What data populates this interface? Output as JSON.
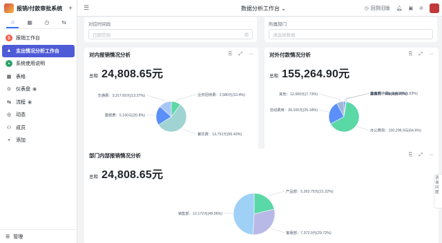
{
  "app": {
    "title": "报销/付款审批系统",
    "add_icon": "plus-icon"
  },
  "sidebar": {
    "tabs": [
      {
        "name": "home",
        "icon": "home-icon",
        "active": true
      },
      {
        "name": "table",
        "icon": "table-icon",
        "active": false
      },
      {
        "name": "history",
        "icon": "clock-icon",
        "active": false
      },
      {
        "name": "workflow",
        "icon": "flow-icon",
        "active": false
      }
    ],
    "items": [
      {
        "label": "报销工作台",
        "icon": "dollar-icon",
        "active": false
      },
      {
        "label": "支出情况分析工作台",
        "icon": "chart-icon",
        "active": true
      },
      {
        "label": "系统使用说明",
        "icon": "doc-icon",
        "active": false
      },
      {
        "label": "表格",
        "icon": "grid-icon",
        "active": false
      },
      {
        "label": "仪表盘",
        "icon": "gauge-icon",
        "active": false
      },
      {
        "label": "流程",
        "icon": "flow-icon",
        "active": false
      },
      {
        "label": "动态",
        "icon": "activity-icon",
        "active": false
      },
      {
        "label": "成员",
        "icon": "users-icon",
        "active": false
      },
      {
        "label": "添加",
        "icon": "plus-icon",
        "active": false
      }
    ],
    "bottom_label": "管理"
  },
  "topbar": {
    "title": "数据分析工作台",
    "back_label": "回到旧版"
  },
  "filters": {
    "date_label": "对应时间段",
    "date_placeholder": "日期范围",
    "dept_label": "所属部门",
    "dept_placeholder": "请选择数据"
  },
  "float_tab": "咨询 问题",
  "cards": [
    {
      "id": "internal",
      "title": "对内报销情况分析",
      "kpi_label": "总和",
      "kpi_value": "24,808.65元"
    },
    {
      "id": "external",
      "title": "对外付款情况分析",
      "kpi_label": "总和",
      "kpi_value": "155,264.90元"
    },
    {
      "id": "department",
      "title": "部门内部报销情况分析",
      "kpi_label": "总和",
      "kpi_value": "24,808.65元"
    }
  ],
  "chart_data": [
    {
      "type": "pie",
      "title": "对内报销情况分析",
      "slices": [
        {
          "label": "业务招待费",
          "value": 2580,
          "display": "业务招待费：2,580元(10.4%)",
          "color": "#5ad8a6"
        },
        {
          "label": "餐饮费",
          "value": 13751,
          "display": "餐饮费：13,751元(55.43%)",
          "color": "#9fd4d2"
        },
        {
          "label": "差旅费",
          "value": 5160,
          "display": "差旅费：5,160元(20.8%)",
          "color": "#5b8ff9"
        },
        {
          "label": "交通费",
          "value": 3317.65,
          "display": "交通费：3,317.65元(13.37%)",
          "color": "#a7c6f7"
        }
      ]
    },
    {
      "type": "pie",
      "title": "对外付款情况分析",
      "slices": [
        {
          "label": "业务招待费",
          "value": 3000,
          "display": "业务招待费：3,000元(1.93%)",
          "color": "#5b8ff9"
        },
        {
          "label": "差旅费",
          "value": 321,
          "display": "差旅费：321元(0.21%)",
          "color": "#6dc8ec"
        },
        {
          "label": "服务费",
          "value": 546,
          "display": "服务费：546元(0.35%)",
          "color": "#945fb9"
        },
        {
          "label": "交通费",
          "value": 1,
          "display": "交通费：1元(0%)",
          "color": "#ff9845"
        },
        {
          "label": "办公费用",
          "value": 100296.9,
          "display": "办公费用：100,296.9元(64.6%)",
          "color": "#5ad8a6"
        },
        {
          "label": "活动费用",
          "value": 39100,
          "display": "活动费用：39,100元(25.18%)",
          "color": "#5b8ff9"
        },
        {
          "label": "其他",
          "value": 12000,
          "display": "其他：12,000元(7.73%)",
          "color": "#9fb6d8"
        }
      ]
    },
    {
      "type": "pie",
      "title": "部门内部报销情况分析",
      "slices": [
        {
          "label": "产品部",
          "value": 5263.75,
          "display": "产品部：5,263.75元(21.22%)",
          "color": "#5ad8a6"
        },
        {
          "label": "客服部",
          "value": 7372.9,
          "display": "客服部：7,372.9元(29.72%)",
          "color": "#b8b9e6"
        },
        {
          "label": "销售部",
          "value": 12172,
          "display": "销售部：12,172元(49.06%)",
          "color": "#9fd0f5"
        }
      ]
    }
  ]
}
